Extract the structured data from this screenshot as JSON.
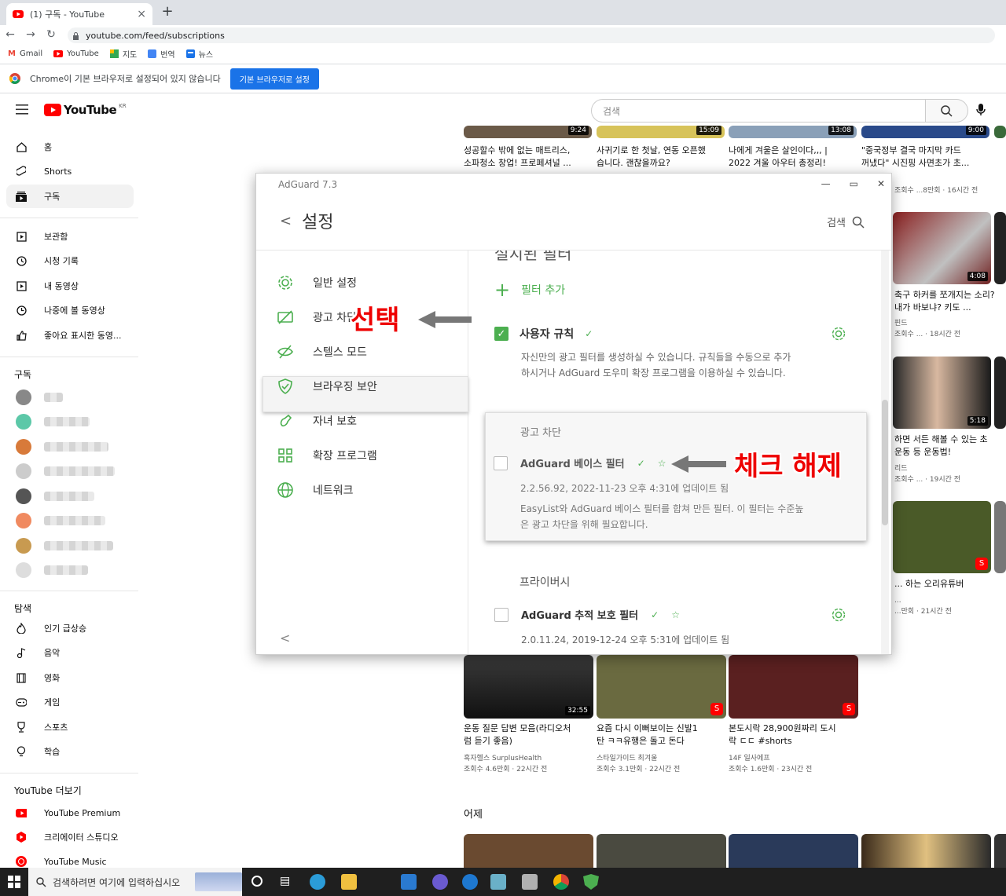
{
  "browser": {
    "tab_title": "(1) 구독 - YouTube",
    "url": "youtube.com/feed/subscriptions",
    "bookmarks": [
      "Gmail",
      "YouTube",
      "지도",
      "번역",
      "뉴스"
    ],
    "infobar_text": "Chrome이 기본 브라우저로 설정되어 있지 않습니다",
    "infobar_button": "기본 브라우저로 설정"
  },
  "youtube": {
    "logo": "YouTube",
    "region": "KR",
    "search_placeholder": "검색",
    "nav": [
      {
        "label": "홈",
        "icon": "home-icon"
      },
      {
        "label": "Shorts",
        "icon": "shorts-icon"
      },
      {
        "label": "구독",
        "icon": "subscriptions-icon",
        "active": true
      }
    ],
    "library": [
      {
        "label": "보관함",
        "icon": "library-icon"
      },
      {
        "label": "시청 기록",
        "icon": "history-icon"
      },
      {
        "label": "내 동영상",
        "icon": "my-videos-icon"
      },
      {
        "label": "나중에 볼 동영상",
        "icon": "watch-later-icon"
      },
      {
        "label": "좋아요 표시한 동영...",
        "icon": "liked-icon"
      }
    ],
    "subs_heading": "구독",
    "explore_heading": "탐색",
    "explore": [
      {
        "label": "인기 급상승",
        "icon": "trending-icon"
      },
      {
        "label": "음악",
        "icon": "music-icon"
      },
      {
        "label": "영화",
        "icon": "movies-icon"
      },
      {
        "label": "게임",
        "icon": "gaming-icon"
      },
      {
        "label": "스포츠",
        "icon": "sports-icon"
      },
      {
        "label": "학습",
        "icon": "learning-icon"
      }
    ],
    "more_heading": "YouTube 더보기",
    "more": [
      {
        "label": "YouTube Premium",
        "icon": "youtube-premium-icon"
      },
      {
        "label": "크리에이터 스튜디오",
        "icon": "studio-icon"
      },
      {
        "label": "YouTube Music",
        "icon": "youtube-music-icon"
      }
    ],
    "top_row": [
      {
        "dur": "9:24",
        "title1": "성공할수 밖에 없는 매트리스,",
        "title2": "소파청소 창업! 프로페셔널 ..."
      },
      {
        "dur": "15:09",
        "title1": "사귀기로 한 첫날, 연동 오픈했",
        "title2": "습니다. 괜찮을까요?"
      },
      {
        "dur": "13:08",
        "title1": "나에게 겨울은 살인이다,,, |",
        "title2": "2022 겨울 아우터 총정리!"
      },
      {
        "dur": "9:00",
        "title1": "\"중국정부 결국 마지막 카드",
        "title2": "꺼냈다\" 시진핑 사면초가 초..."
      }
    ],
    "right_col": [
      {
        "dur": "4:08",
        "title1": "축구 하커를 쪼개지는 소리?",
        "title2": "내가 바보냐? 키도 ...",
        "meta1": "핀드",
        "meta2": "조회수 ... · 18시간 전"
      },
      {
        "dur": "5:18",
        "title1": "하면 서든 해볼 수 있는 초",
        "title2": "운동 등 운동법!",
        "meta1": "리드",
        "meta2": "조회수 ... · 19시간 전"
      },
      {
        "title1": "... 하는 오리유튜버",
        "title2": "",
        "meta1": "...",
        "meta2": "...만회 · 21시간 전"
      }
    ],
    "right_top_meta": "조회수 ...8만회 · 16시간 전",
    "bottom_row": [
      {
        "dur": "32:55",
        "title1": "운동 질문 답변 모음(라디오처",
        "title2": "럼 듣기 좋음)",
        "channel": "흑자헬스 SurplusHealth",
        "meta": "조회수 4.6만회 · 22시간 전"
      },
      {
        "title1": "요즘 다시 이뻐보이는 신발1",
        "title2": "탄 ㅋㅋ유행은 돌고 돈다",
        "channel": "스타일가이드 최겨울",
        "meta": "조회수 3.1만회 · 22시간 전"
      },
      {
        "title1": "본도시락 28,900원짜리 도시",
        "title2": "락 ㄷㄷ #shorts",
        "channel": "14F 일사에프",
        "meta": "조회수 1.6만회 · 23시간 전"
      }
    ],
    "yesterday": "어제"
  },
  "adguard": {
    "title": "AdGuard 7.3",
    "page_title": "설정",
    "search": "검색",
    "nav": [
      {
        "label": "일반 설정",
        "icon": "gear-icon"
      },
      {
        "label": "광고 차단",
        "icon": "ad-block-icon"
      },
      {
        "label": "스텔스 모드",
        "icon": "stealth-icon"
      },
      {
        "label": "브라우징 보안",
        "icon": "shield-icon"
      },
      {
        "label": "자녀 보호",
        "icon": "parental-icon"
      },
      {
        "label": "확장 프로그램",
        "icon": "extensions-icon"
      },
      {
        "label": "네트워크",
        "icon": "globe-icon"
      }
    ],
    "section_partial": "설치된 필터",
    "add_filter": "필터 추가",
    "user_rules": {
      "label": "사용자 규칙",
      "desc1": "자신만의 광고 필터를 생성하실 수 있습니다. 규칙들을 수동으로 추가",
      "desc2": "하시거나 AdGuard 도우미 확장 프로그램을 이용하실 수 있습니다."
    },
    "ad_block_group": "광고 차단",
    "base_filter": {
      "label": "AdGuard 베이스 필터",
      "version": "2.2.56.92, 2022-11-23 오후 4:31에 업데이트 됨",
      "desc1": "EasyList와 AdGuard 베이스 필터를 합쳐 만든 필터. 이 필터는 수준높",
      "desc2": "은 광고 차단을 위해 필요합니다."
    },
    "privacy_group": "프라이버시",
    "tracking_filter": {
      "label": "AdGuard 추적 보호 필터",
      "version": "2.0.11.24, 2019-12-24 오후 5:31에 업데이트 됨"
    }
  },
  "annotations": {
    "select": "선택",
    "uncheck": "체크 해제"
  },
  "taskbar": {
    "search_placeholder": "검색하려면 여기에 입력하십시오"
  },
  "colors": {
    "youtube_red": "#ff0000",
    "adguard_green": "#4caf50",
    "annotation_red": "#ee0000",
    "chrome_blue": "#1a73e8"
  }
}
